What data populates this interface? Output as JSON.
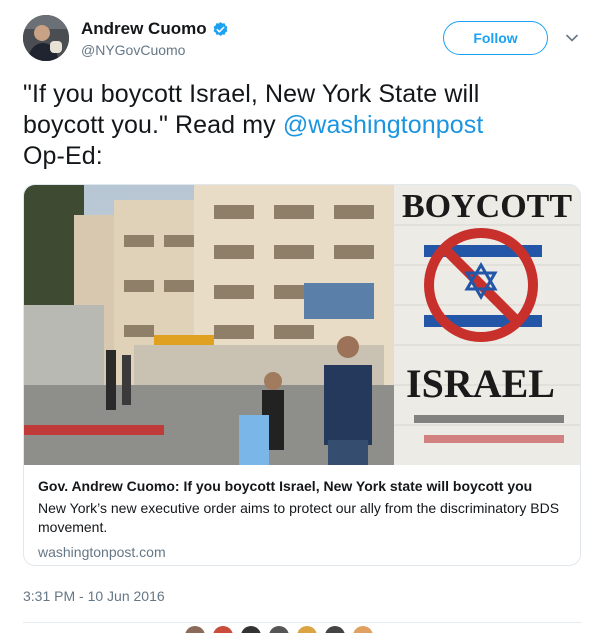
{
  "author": {
    "display_name": "Andrew Cuomo",
    "handle": "@NYGovCuomo",
    "verified_icon": "verified-badge-icon"
  },
  "follow_label": "Follow",
  "tweet": {
    "text_before": "\"If you boycott Israel, New York State will boycott you.\" Read my ",
    "mention": "@washingtonpost",
    "text_after": " Op-Ed:"
  },
  "card": {
    "image_wall_text_top": "BOYCOTT",
    "image_wall_text_main": "ISRAEL",
    "title": "Gov. Andrew Cuomo: If you boycott Israel, New York state will boycott you",
    "description": "New York’s new executive order aims to protect our ally from the discriminatory BDS movement.",
    "domain": "washingtonpost.com"
  },
  "timestamp": "3:31 PM - 10 Jun 2016",
  "colors": {
    "accent": "#1da1f2",
    "link": "#1b95e0",
    "muted": "#657786"
  }
}
